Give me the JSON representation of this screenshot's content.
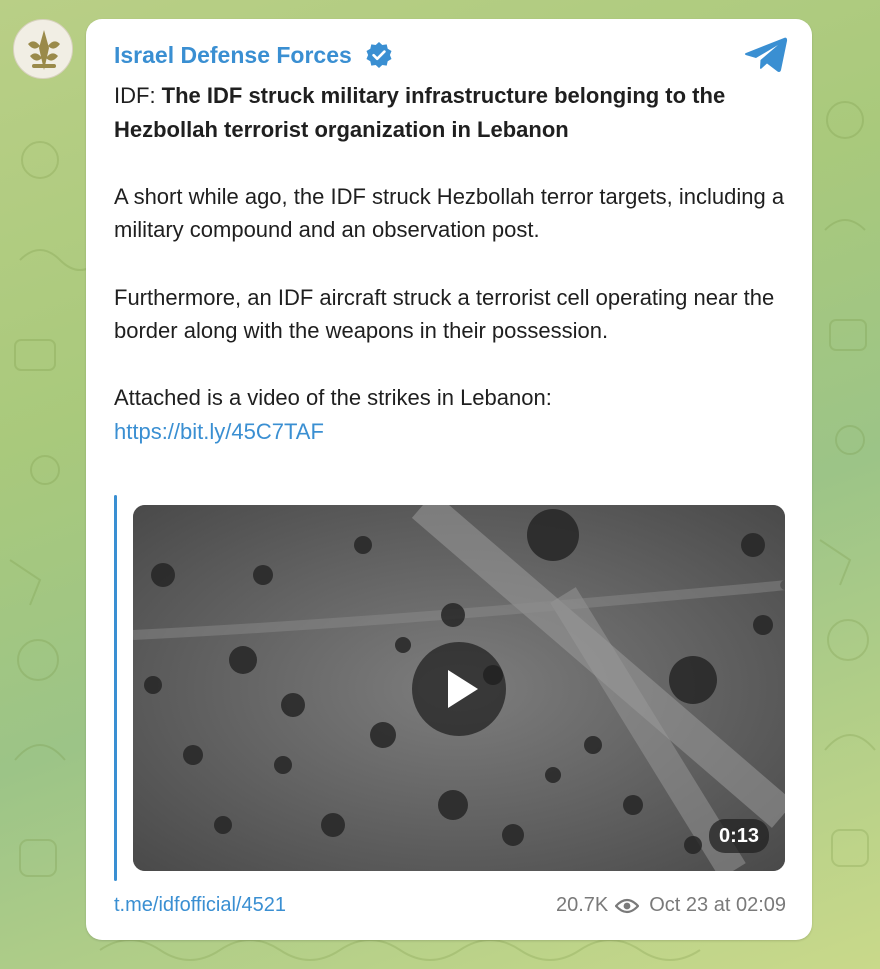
{
  "channel": {
    "name": "Israel Defense Forces",
    "verified": true,
    "avatar_icon": "idf-emblem-icon",
    "app_icon": "telegram-icon"
  },
  "post": {
    "prefix": "IDF: ",
    "headline": "The IDF struck military infrastructure belonging to the Hezbollah terrorist organization in Lebanon",
    "paragraph1": "A short while ago, the IDF struck Hezbollah terror targets, including a military compound and an observation post.",
    "paragraph2": "Furthermore, an IDF aircraft struck a terrorist cell operating near the border along with the weapons in their possession.",
    "paragraph3": "Attached is a video of the strikes in Lebanon:",
    "link": "https://bit.ly/45C7TAF"
  },
  "video": {
    "duration": "0:13",
    "play_icon": "play-icon"
  },
  "footer": {
    "short_link": "t.me/idfofficial/4521",
    "views": "20.7K",
    "views_icon": "eye-icon",
    "date": "Oct 23 at 02:09"
  },
  "colors": {
    "accent": "#3a8fd2",
    "text": "#1f1f1f",
    "meta": "#7a7a7a",
    "card": "#ffffff"
  }
}
